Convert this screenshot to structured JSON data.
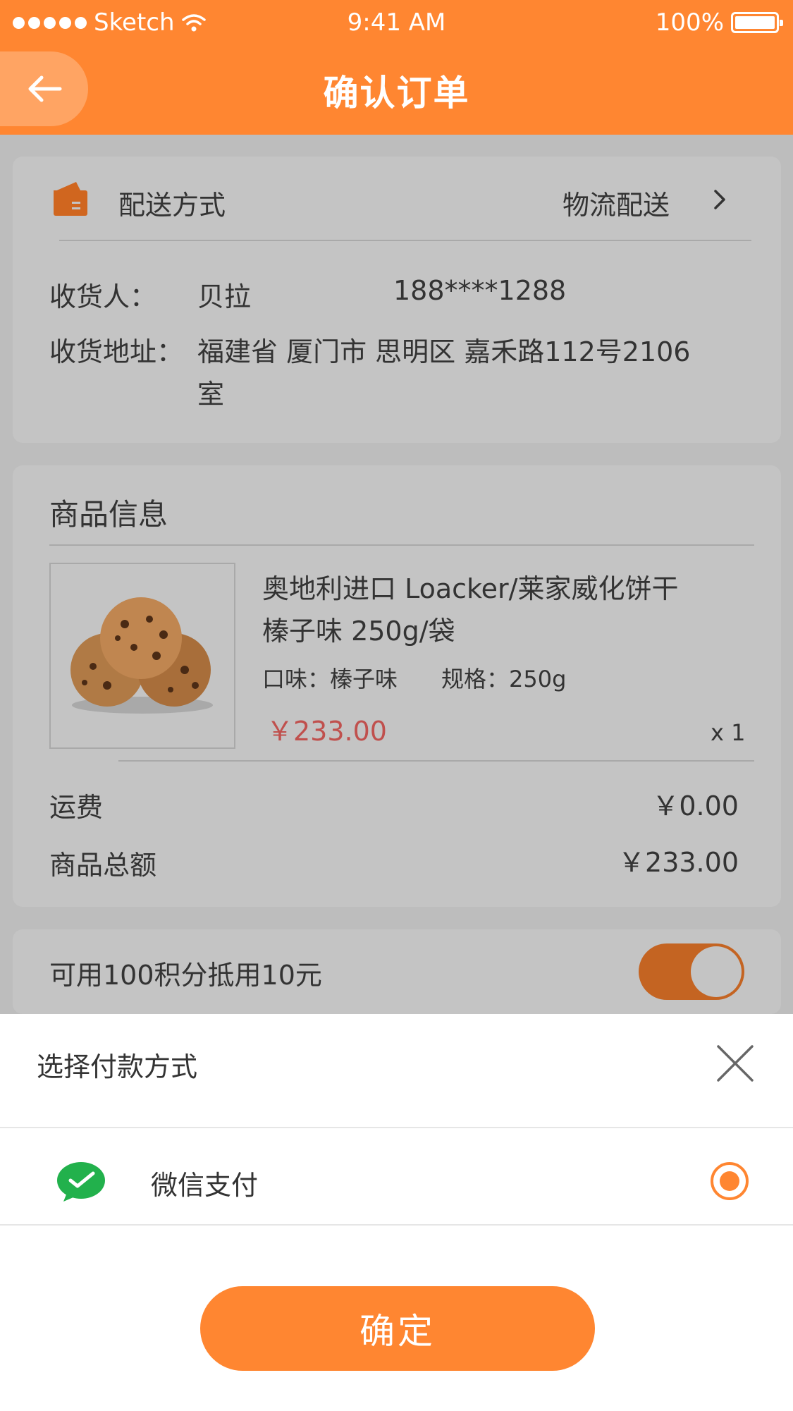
{
  "status_bar": {
    "carrier": "Sketch",
    "time": "9:41 AM",
    "battery": "100%"
  },
  "nav": {
    "title": "确认订单"
  },
  "delivery": {
    "label": "配送方式",
    "value": "物流配送",
    "recipient_label": "收货人：",
    "recipient_name": "贝拉",
    "phone": "188****1288",
    "address_label": "收货地址：",
    "address_line1": "福建省 厦门市 思明区 嘉禾路112号2106",
    "address_line2": "室"
  },
  "product": {
    "section_title": "商品信息",
    "name_line1": "奥地利进口 Loacker/莱家威化饼干",
    "name_line2": "榛子味 250g/袋",
    "flavor": "口味：榛子味",
    "spec": "规格：250g",
    "price": "￥233.00",
    "quantity": "x 1",
    "shipping_label": "运费",
    "shipping_value": "￥0.00",
    "total_label": "商品总额",
    "total_value": "￥233.00"
  },
  "points": {
    "label": "可用100积分抵用10元",
    "toggle_on": true
  },
  "payment_sheet": {
    "title": "选择付款方式",
    "method_label": "微信支付",
    "confirm_label": "确定"
  }
}
